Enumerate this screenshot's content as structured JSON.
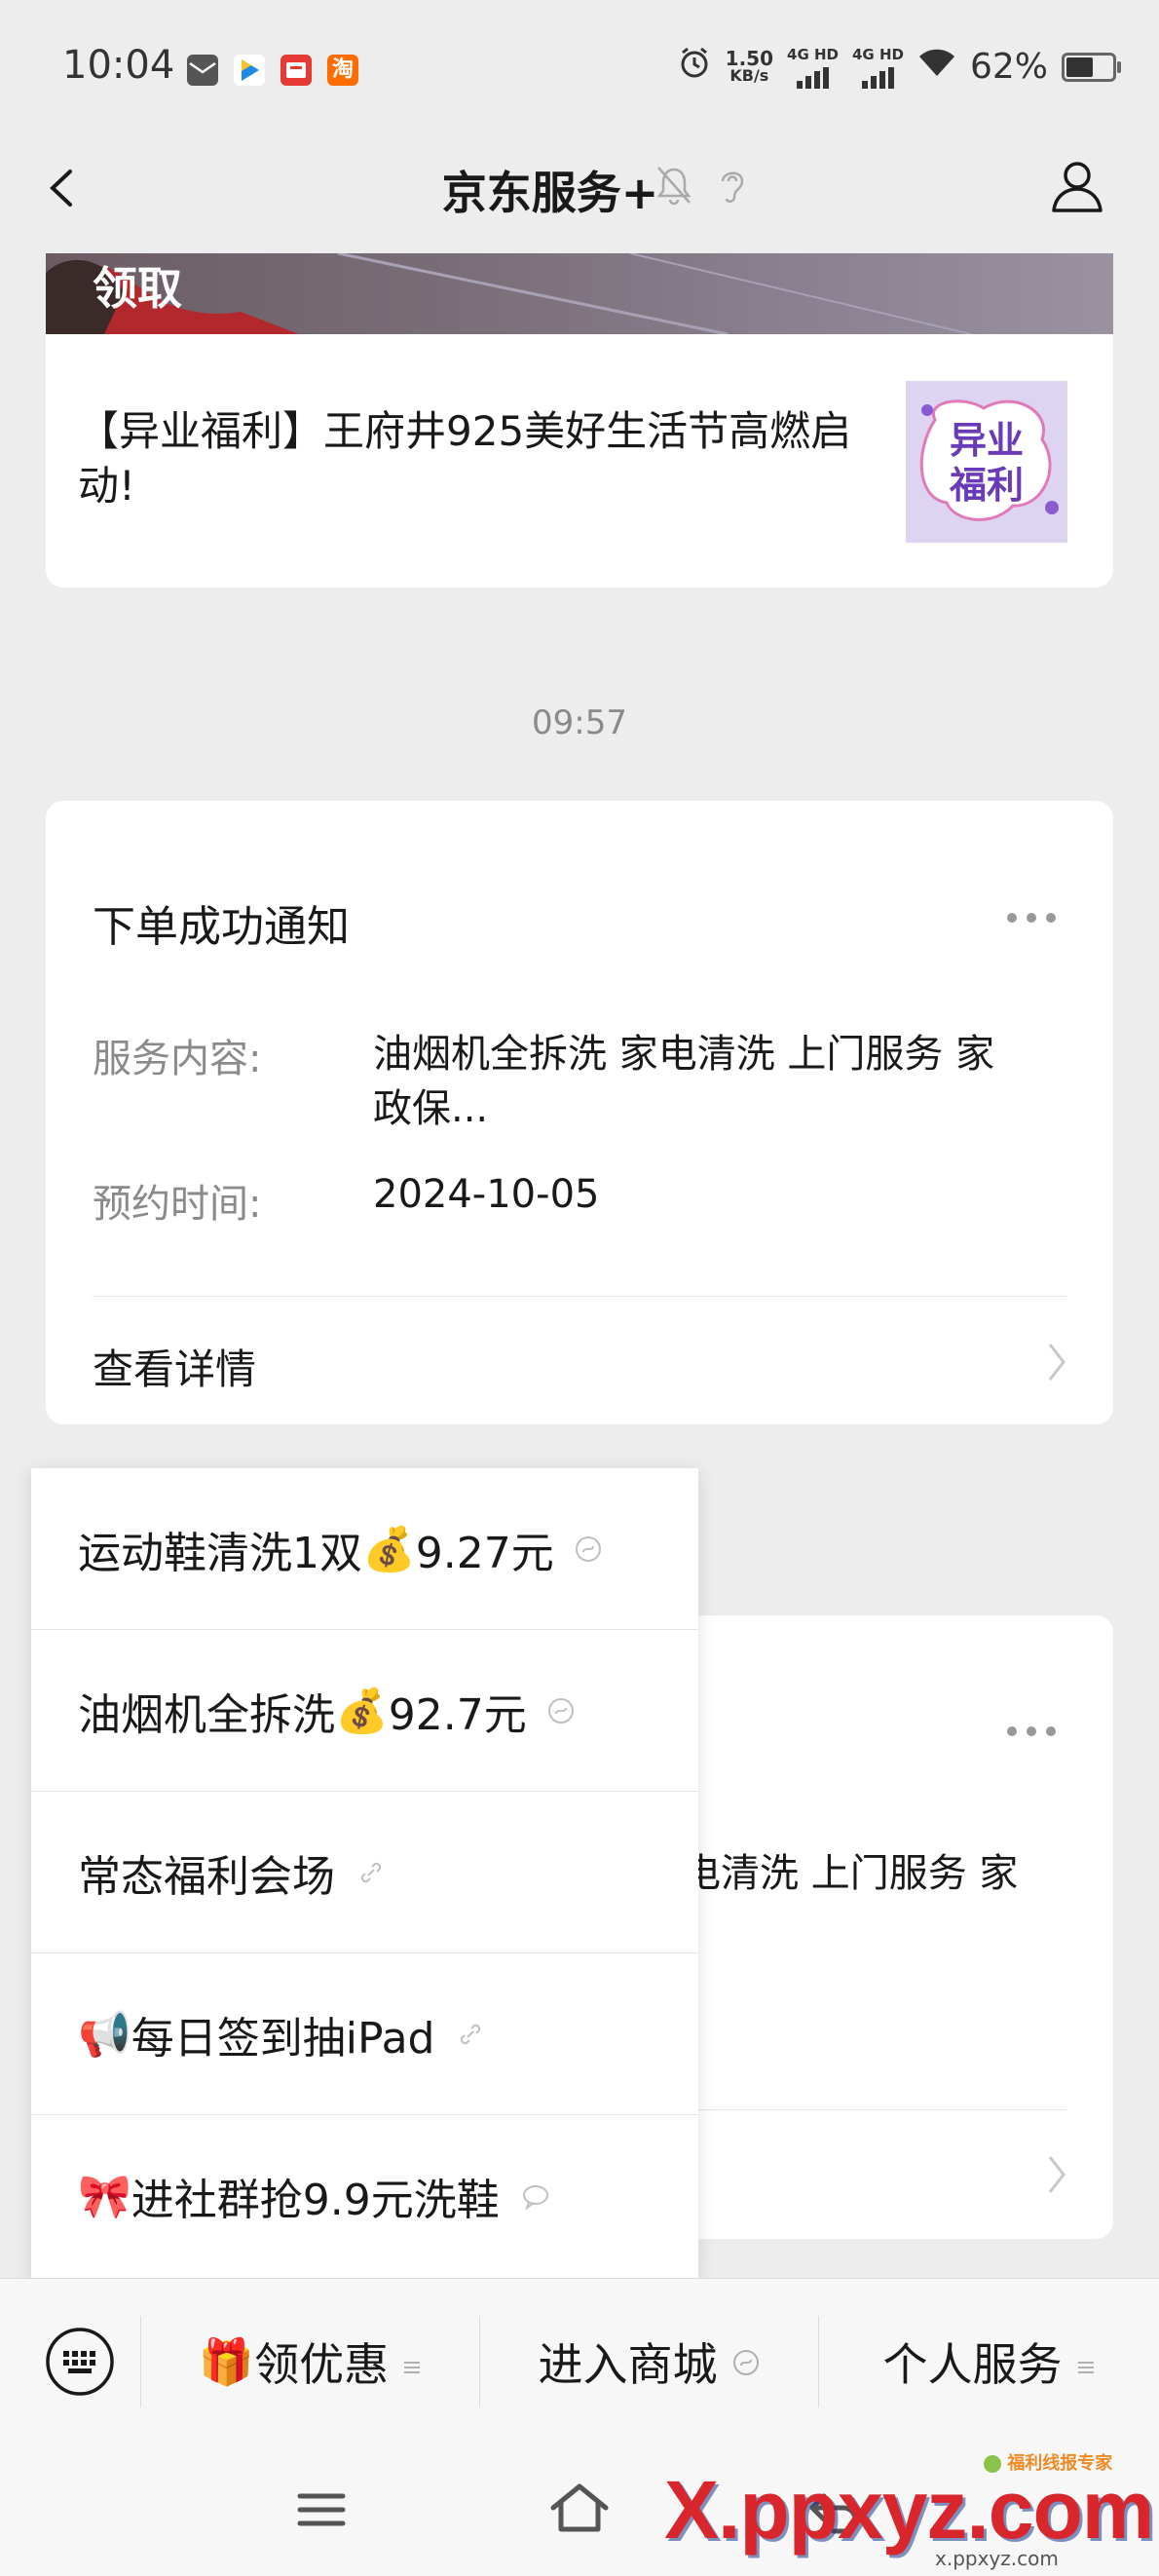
{
  "status_bar": {
    "time": "10:04",
    "speed_top": "1.50",
    "speed_bottom": "KB/s",
    "net1": "4G HD",
    "net2": "4G HD",
    "battery": "62%",
    "battery_level": 0.62
  },
  "nav": {
    "title": "京东服务+"
  },
  "article_card": {
    "banner_text": "领取",
    "title": "【异业福利】王府井925美好生活节高燃启动!",
    "thumb_text_line1": "异业",
    "thumb_text_line2": "福利"
  },
  "timestamp": "09:57",
  "notice_card": {
    "title": "下单成功通知",
    "service_label": "服务内容:",
    "service_value_line1": "油烟机全拆洗 家电清洗 上门服务 家",
    "service_value_line2": "政保...",
    "time_label": "预约时间:",
    "time_value": "2024-10-05",
    "detail_link": "查看详情"
  },
  "notice_card_2": {
    "partial_text": "电清洗 上门服务 家"
  },
  "menu": {
    "items": [
      {
        "label": "运动鞋清洗1双",
        "emoji": "💰",
        "price": "9.27元"
      },
      {
        "label": "油烟机全拆洗",
        "emoji": "💰",
        "price": "92.7元"
      },
      {
        "label": "常态福利会场",
        "emoji": "",
        "price": ""
      },
      {
        "label": "每日签到抽iPad",
        "emoji": "📢",
        "price": ""
      },
      {
        "label": "进社群抢9.9元洗鞋",
        "emoji": "🎀",
        "price": ""
      }
    ]
  },
  "bottom_bar": {
    "item1": "领优惠",
    "item1_emoji": "🎁",
    "item2": "进入商城",
    "item3": "个人服务"
  },
  "watermark": {
    "main": "X.ppxyz.com",
    "sub": "福利线报专家",
    "small": "x.ppxyz.com"
  },
  "colors": {
    "background": "#ededed",
    "card": "#ffffff",
    "label": "#8a8a8a",
    "watermark_red": "#d8262c",
    "watermark_blue": "#1a3a8c"
  }
}
